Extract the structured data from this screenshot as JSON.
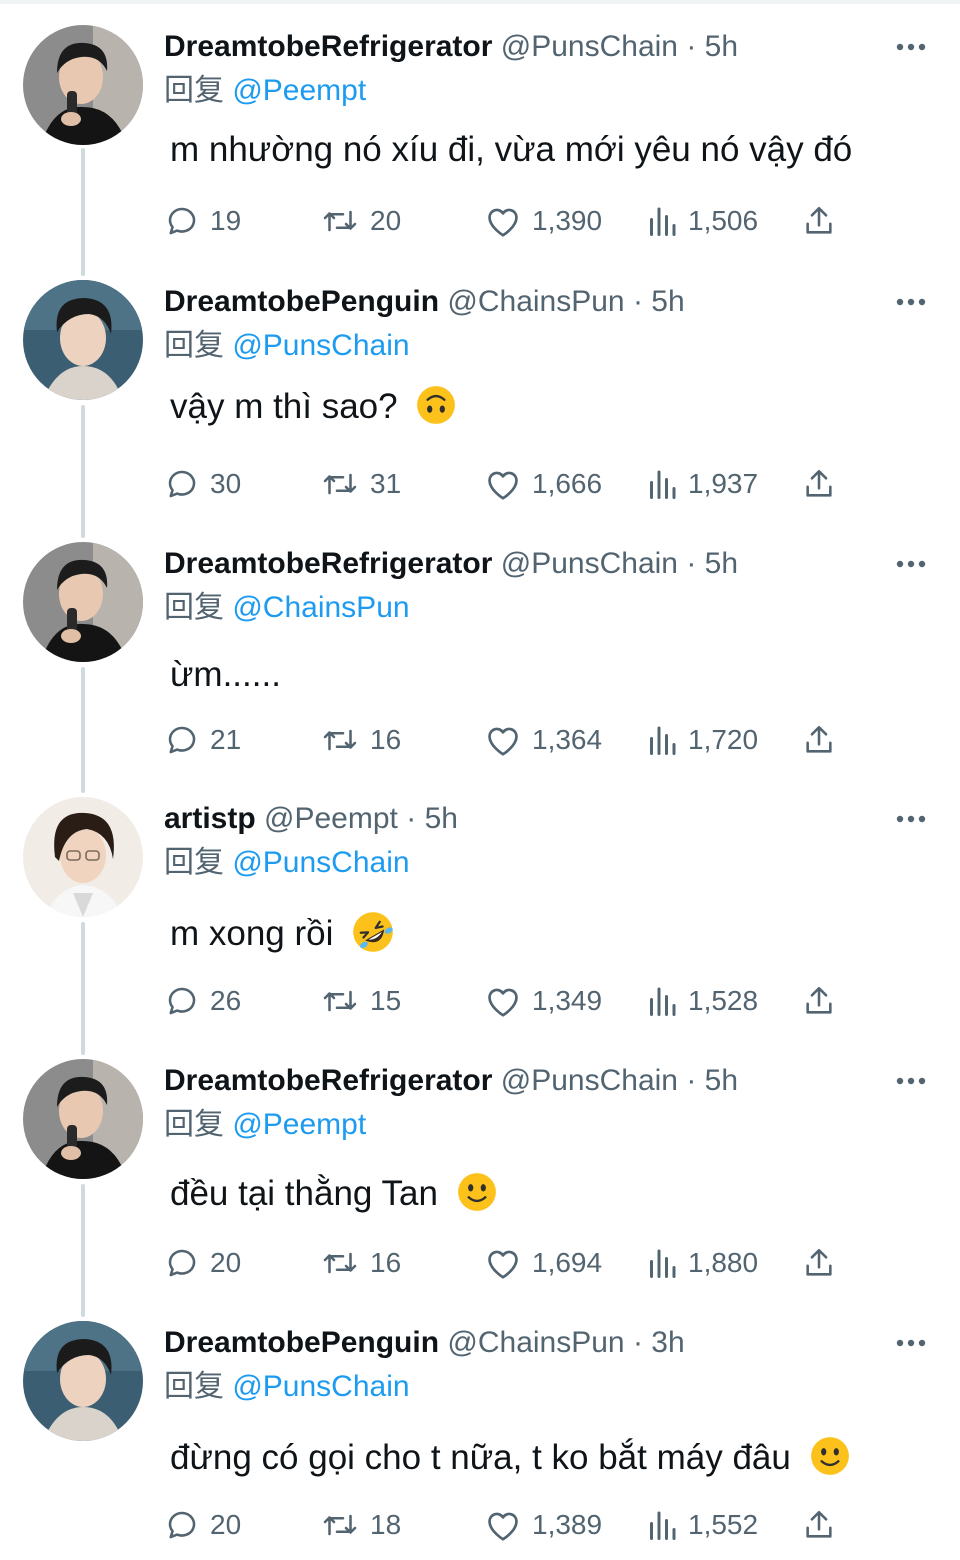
{
  "reply_prefix": "回复",
  "colors": {
    "accent": "#1d9bf0",
    "secondary_text": "#536471",
    "thread_line": "#cfd9de"
  },
  "tweets": [
    {
      "display_name": "DreamtobeRefrigerator",
      "handle": "@PunsChain",
      "dot": "·",
      "time": "5h",
      "reply_to": "@Peempt",
      "text": "m nhường nó xíu đi, vừa mới yêu nó vậy đó",
      "emoji": "",
      "replies": "19",
      "retweets": "20",
      "likes": "1,390",
      "views": "1,506"
    },
    {
      "display_name": "DreamtobePenguin",
      "handle": "@ChainsPun",
      "dot": "·",
      "time": "5h",
      "reply_to": "@PunsChain",
      "text": "vậy m thì sao?",
      "emoji": "upside-down-face",
      "replies": "30",
      "retweets": "31",
      "likes": "1,666",
      "views": "1,937"
    },
    {
      "display_name": "DreamtobeRefrigerator",
      "handle": "@PunsChain",
      "dot": "·",
      "time": "5h",
      "reply_to": "@ChainsPun",
      "text": "ừm......",
      "emoji": "",
      "replies": "21",
      "retweets": "16",
      "likes": "1,364",
      "views": "1,720"
    },
    {
      "display_name": "artistp",
      "handle": "@Peempt",
      "dot": "·",
      "time": "5h",
      "reply_to": "@PunsChain",
      "text": "m xong rồi",
      "emoji": "rolling-on-floor-laughing",
      "replies": "26",
      "retweets": "15",
      "likes": "1,349",
      "views": "1,528"
    },
    {
      "display_name": "DreamtobeRefrigerator",
      "handle": "@PunsChain",
      "dot": "·",
      "time": "5h",
      "reply_to": "@Peempt",
      "text": "đều tại thằng Tan",
      "emoji": "slightly-smiling-face",
      "replies": "20",
      "retweets": "16",
      "likes": "1,694",
      "views": "1,880"
    },
    {
      "display_name": "DreamtobePenguin",
      "handle": "@ChainsPun",
      "dot": "·",
      "time": "3h",
      "reply_to": "@PunsChain",
      "text": "đừng có gọi cho t nữa, t ko bắt máy đâu",
      "emoji": "slightly-smiling-face",
      "replies": "20",
      "retweets": "18",
      "likes": "1,389",
      "views": "1,552"
    }
  ]
}
